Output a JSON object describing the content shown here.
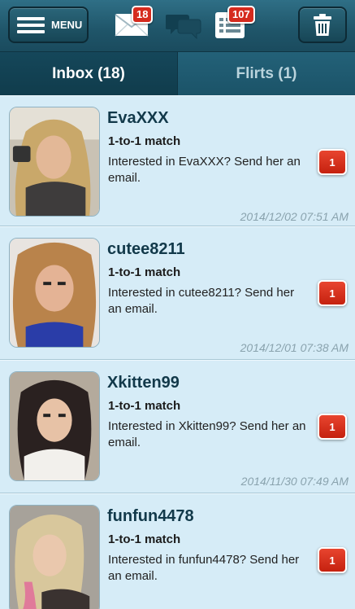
{
  "toolbar": {
    "menu_label": "MENU",
    "mail_badge": "18",
    "list_badge": "107",
    "icons": {
      "menu": "hamburger-icon",
      "mail": "envelope-icon",
      "chat": "chat-bubbles-icon",
      "list": "list-icon",
      "trash": "trash-icon"
    }
  },
  "tabs": [
    {
      "label": "Inbox (18)",
      "active": true
    },
    {
      "label": "Flirts (1)",
      "active": false
    }
  ],
  "messages": [
    {
      "name": "EvaXXX",
      "type": "1-to-1 match",
      "text": "Interested in EvaXXX? Send her an email.",
      "count": "1",
      "time": "2014/12/02 07:51 AM"
    },
    {
      "name": "cutee8211",
      "type": "1-to-1 match",
      "text": "Interested in cutee8211? Send her an email.",
      "count": "1",
      "time": "2014/12/01 07:38 AM"
    },
    {
      "name": "Xkitten99",
      "type": "1-to-1 match",
      "text": "Interested in Xkitten99? Send her an email.",
      "count": "1",
      "time": "2014/11/30 07:49 AM"
    },
    {
      "name": "funfun4478",
      "type": "1-to-1 match",
      "text": "Interested in funfun4478? Send her an email.",
      "count": "1",
      "time": ""
    }
  ],
  "colors": {
    "toolbar": "#1f5569",
    "list_bg": "#d6ecf7",
    "badge": "#d52b1e",
    "name": "#12394a"
  }
}
